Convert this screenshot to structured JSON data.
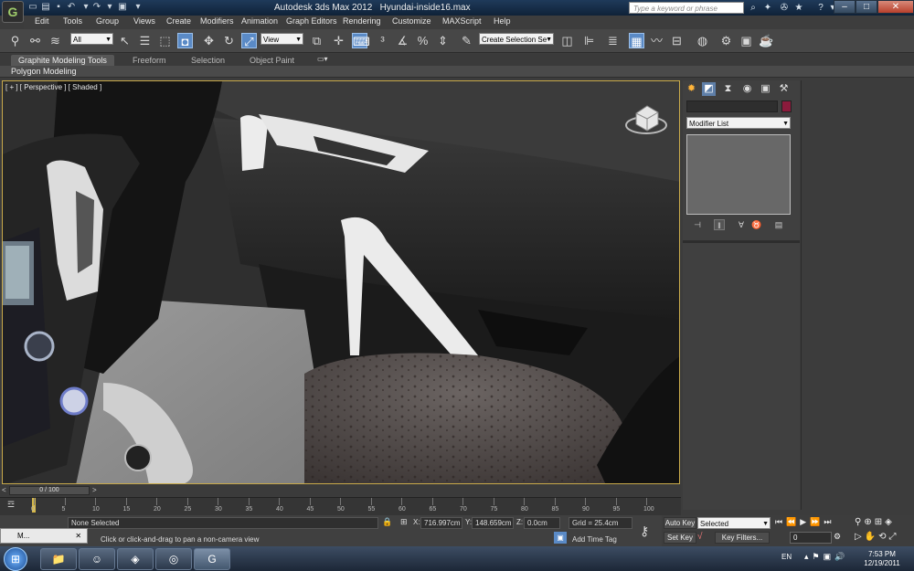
{
  "titlebar": {
    "app": "Autodesk 3ds Max  2012",
    "file": "Hyundai-inside16.max",
    "search_placeholder": "Type a keyword or phrase"
  },
  "menu": [
    "Edit",
    "Tools",
    "Group",
    "Views",
    "Create",
    "Modifiers",
    "Animation",
    "Graph Editors",
    "Rendering",
    "Customize",
    "MAXScript",
    "Help"
  ],
  "toolbar": {
    "selection_filter": "All",
    "ref_coord": "View",
    "named_selection": "Create Selection Se"
  },
  "ribbon": {
    "tabs": [
      "Graphite Modeling Tools",
      "Freeform",
      "Selection",
      "Object Paint"
    ],
    "active_tab": "Graphite Modeling Tools",
    "panel": "Polygon Modeling"
  },
  "viewport": {
    "label": "[ + ] [ Perspective ] [ Shaded ]"
  },
  "command_panel": {
    "modifier_list": "Modifier List"
  },
  "timeline": {
    "frame": "0 / 100",
    "ticks": [
      "0",
      "5",
      "10",
      "15",
      "20",
      "25",
      "30",
      "35",
      "40",
      "45",
      "50",
      "55",
      "60",
      "65",
      "70",
      "75",
      "80",
      "85",
      "90",
      "95",
      "100"
    ]
  },
  "status": {
    "selection": "None Selected",
    "prompt": "Click or click-and-drag to pan a non-camera view",
    "x_label": "X:",
    "x": "716.997cm",
    "y_label": "Y:",
    "y": "148.659cm",
    "z_label": "Z:",
    "z": "0.0cm",
    "grid": "Grid = 25.4cm",
    "add_time_tag": "Add Time Tag"
  },
  "animation": {
    "auto_key": "Auto Key",
    "set_key": "Set Key",
    "key_mode": "Selected",
    "key_filters": "Key Filters...",
    "current_frame": "0"
  },
  "taskbar": {
    "mini_window": "M...",
    "language": "EN",
    "time": "7:53 PM",
    "date": "12/19/2011"
  }
}
